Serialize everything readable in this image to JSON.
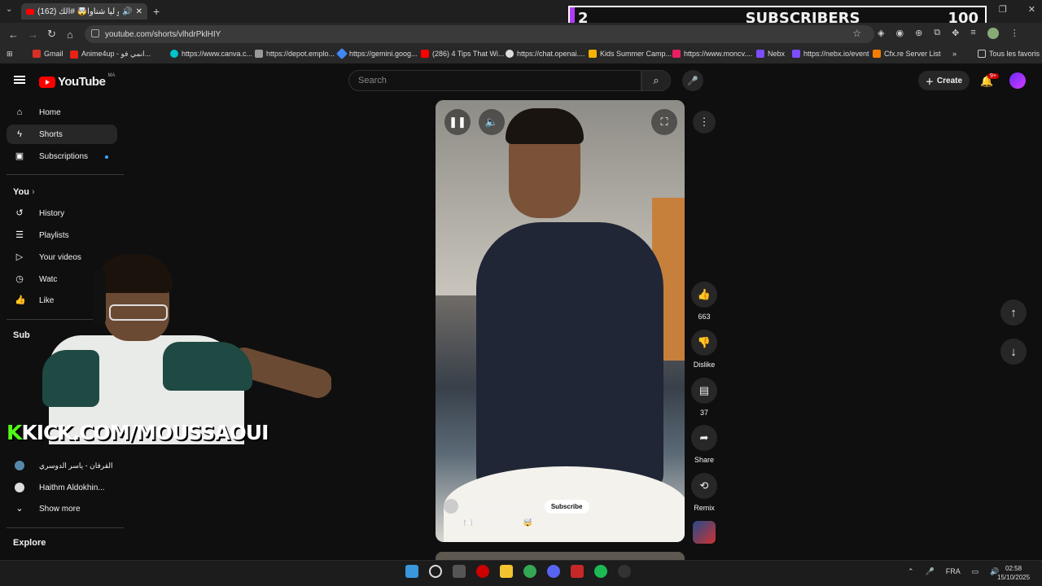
{
  "browser": {
    "tab_title": "(162) طاكو ليا شناوا🤯 #الك",
    "url": "youtube.com/shorts/vlhdrPklHIY",
    "bookmarks": [
      {
        "label": "Gmail",
        "color": "#d93025"
      },
      {
        "label": "Anime4up - انمي فو...",
        "color": "#e62117"
      },
      {
        "label": "https://www.canva.c...",
        "color": "#00c4cc"
      },
      {
        "label": "https://depot.emplo...",
        "color": "#999999"
      },
      {
        "label": "https://gemini.goog...",
        "color": "#4285f4"
      },
      {
        "label": "(286) 4 Tips That Wi...",
        "color": "#ff0000"
      },
      {
        "label": "https://chat.openai....",
        "color": "#dddddd"
      },
      {
        "label": "Kids Summer Camp...",
        "color": "#f4b400"
      },
      {
        "label": "https://www.moncv....",
        "color": "#e91e63"
      },
      {
        "label": "Nebx",
        "color": "#7c4dff"
      },
      {
        "label": "https://nebx.io/event",
        "color": "#7c4dff"
      },
      {
        "label": "Cfx.re Server List",
        "color": "#f57c00"
      },
      {
        "label": "Tous les favoris",
        "color": "#cccccc"
      }
    ]
  },
  "overlay": {
    "subscriber_current": "2",
    "subscriber_label": "SUBSCRIBERS",
    "subscriber_goal": "100",
    "kick_k": "K",
    "kick_text": "KICK.COM/MOUSSAOUI",
    "bar_color": "#b13aff"
  },
  "youtube": {
    "logo_text": "YouTube",
    "country_code": "MA",
    "search_placeholder": "Search",
    "create_label": "Create",
    "notification_count": "9+",
    "sidebar": {
      "items": [
        {
          "label": "Home",
          "icon": "home-icon"
        },
        {
          "label": "Shorts",
          "icon": "shorts-icon"
        },
        {
          "label": "Subscriptions",
          "icon": "subscriptions-icon"
        }
      ],
      "you_header": "You",
      "you_items": [
        {
          "label": "History",
          "icon": "history-icon"
        },
        {
          "label": "Playlists",
          "icon": "playlists-icon"
        },
        {
          "label": "Your videos",
          "icon": "your-videos-icon"
        },
        {
          "label": "Watc",
          "icon": "watch-later-icon"
        },
        {
          "label": "Like",
          "icon": "liked-icon"
        }
      ],
      "subscriptions_header": "Sub",
      "channels": [
        {
          "label": "القرفان - ياسر الدوسري"
        },
        {
          "label": "Haithm Aldokhin..."
        }
      ],
      "show_more": "Show more",
      "explore_header": "Explore"
    },
    "short": {
      "channel": "@anhmedtaroum4205",
      "subscribe_label": "Subscribe",
      "title": "#food🍽️ #الكتوب 🤯 طاكو ليا شناوا"
    },
    "actions": {
      "likes": "663",
      "dislike_label": "Dislike",
      "comments": "37",
      "share_label": "Share",
      "remix_label": "Remix"
    }
  },
  "taskbar": {
    "language": "FRA",
    "time": "02:58",
    "date": "15/10/2025"
  }
}
